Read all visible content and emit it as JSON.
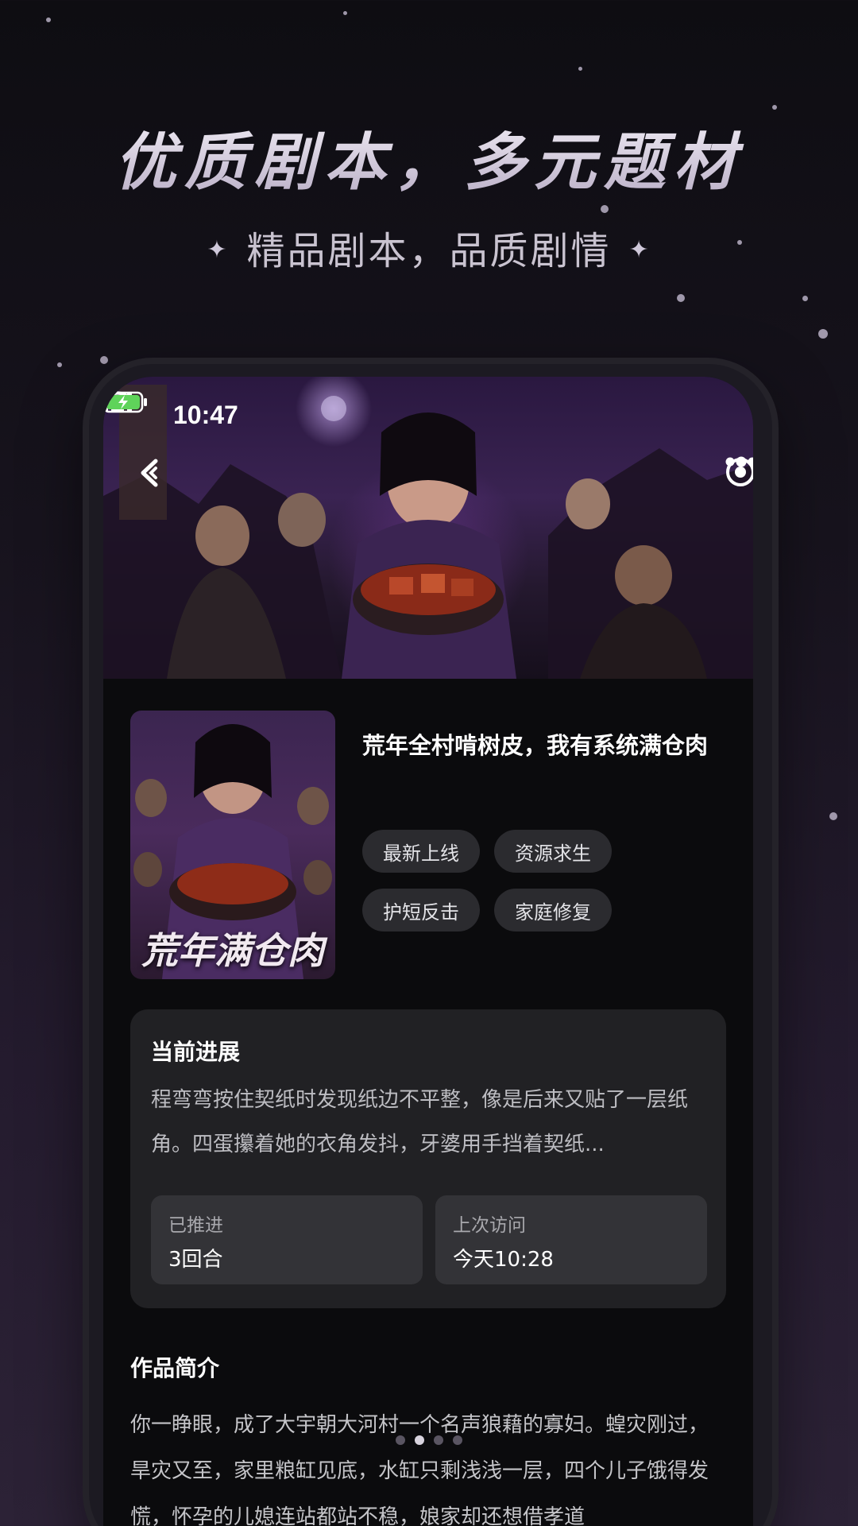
{
  "promo": {
    "headline": "优质剧本，多元题材",
    "subline": "精品剧本，品质剧情"
  },
  "status_bar": {
    "time": "10:47",
    "icons": [
      "signal-icon",
      "wifi-icon",
      "battery-charging-icon"
    ]
  },
  "nav": {
    "back_icon": "back-chevron-icon",
    "more_icon": "more-dots-icon",
    "close_icon": "target-circle-icon"
  },
  "book": {
    "cover_title": "荒年满仓肉",
    "title": "荒年全村啃树皮，我有系统满仓肉",
    "tags": [
      "最新上线",
      "资源求生",
      "护短反击",
      "家庭修复"
    ]
  },
  "progress": {
    "title": "当前进展",
    "text": "程弯弯按住契纸时发现纸边不平整，像是后来又贴了一层纸角。四蛋攥着她的衣角发抖，牙婆用手挡着契纸...",
    "stat1_label": "已推进",
    "stat1_value": "3回合",
    "stat2_label": "上次访问",
    "stat2_value": "今天10:28"
  },
  "intro": {
    "title": "作品简介",
    "text": "你一睁眼，成了大宇朝大河村一个名声狼藉的寡妇。蝗灾刚过，旱灾又至，家里粮缸见底，水缸只剩浅浅一层，四个儿子饿得发慌，怀孕的儿媳连站都站不稳，娘家却还想借孝道"
  },
  "pager": {
    "count": 4,
    "active_index": 1
  },
  "colors": {
    "background": "#17131d",
    "card": "#212124",
    "tag": "#2b2b2f"
  }
}
